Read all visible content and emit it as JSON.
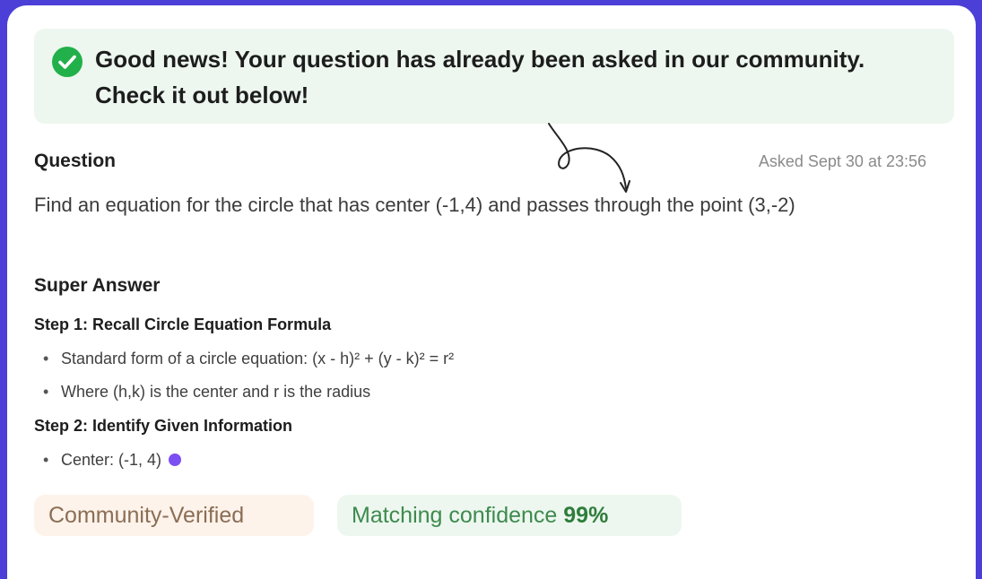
{
  "banner": {
    "message": "Good news! Your question has already been asked in our community. Check it out below!",
    "check_color": "#22b04a"
  },
  "question": {
    "label": "Question",
    "asked": "Asked Sept 30 at 23:56",
    "text": "Find an equation for the circle that has center (-1,4) and passes through the point (3,-2)"
  },
  "answer": {
    "label": "Super Answer",
    "steps": [
      {
        "title": "Step 1: Recall Circle Equation Formula",
        "bullets": [
          "Standard form of a circle equation: (x - h)² + (y - k)² = r²",
          "Where (h,k) is the center and r is the radius"
        ]
      },
      {
        "title": "Step 2: Identify Given Information",
        "bullets": [
          "Center: (-1, 4)"
        ]
      }
    ]
  },
  "tags": {
    "verified": "Community-Verified",
    "confidence_label": "Matching confidence",
    "confidence_value": "99%"
  },
  "colors": {
    "frame": "#4b3fd8",
    "banner_bg": "#edf7ef",
    "streaming_dot": "#7b4ff2"
  }
}
